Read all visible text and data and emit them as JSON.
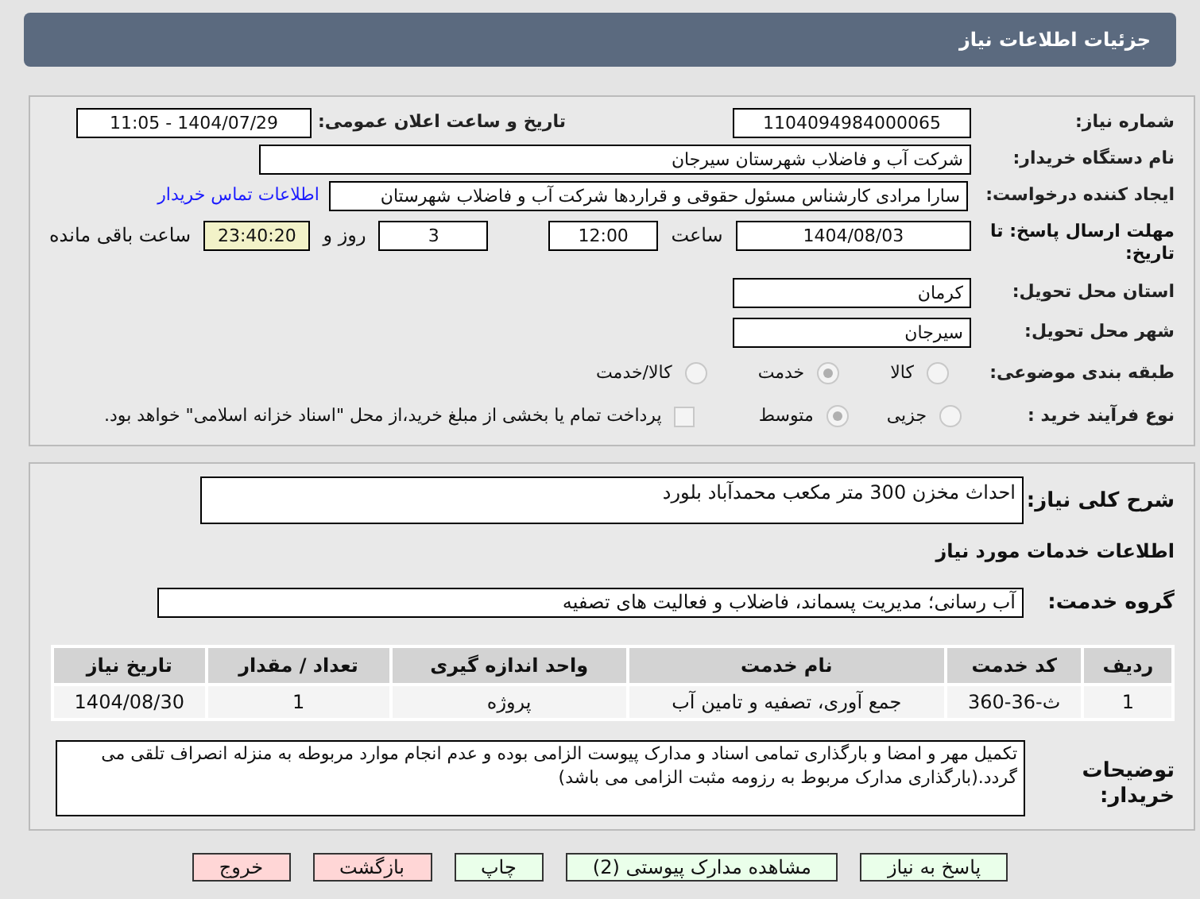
{
  "header": {
    "title": "جزئیات اطلاعات نیاز"
  },
  "details": {
    "need_number": {
      "label": "شماره نیاز:",
      "value": "1104094984000065"
    },
    "announce": {
      "label": "تاریخ و ساعت اعلان عمومی:",
      "value": "1404/07/29 - 11:05"
    },
    "buyer": {
      "label": "نام دستگاه خریدار:",
      "value": "شرکت آب و فاضلاب شهرستان سیرجان"
    },
    "creator": {
      "label": "ایجاد کننده درخواست:",
      "value": "سارا مرادی کارشناس مسئول حقوقی و قراردها شرکت آب و فاضلاب شهرستان",
      "link": "اطلاعات تماس خریدار"
    },
    "deadline": {
      "label": "مهلت ارسال پاسخ: تا تاریخ:",
      "date": "1404/08/03",
      "time_label": "ساعت",
      "time": "12:00",
      "days": "3",
      "days_label": "روز و",
      "remaining": "23:40:20",
      "remaining_label": "ساعت باقی مانده"
    },
    "province": {
      "label": "استان محل تحویل:",
      "value": "کرمان"
    },
    "city": {
      "label": "شهر محل تحویل:",
      "value": "سیرجان"
    },
    "category": {
      "label": "طبقه بندی موضوعی:",
      "options": [
        {
          "label": "کالا",
          "selected": false
        },
        {
          "label": "خدمت",
          "selected": true
        },
        {
          "label": "کالا/خدمت",
          "selected": false
        }
      ]
    },
    "process": {
      "label": "نوع فرآیند خرید :",
      "options": [
        {
          "label": "جزیی",
          "selected": false
        },
        {
          "label": "متوسط",
          "selected": true
        }
      ],
      "payment": {
        "label": "پرداخت تمام یا بخشی از مبلغ خرید،از محل \"اسناد خزانه اسلامی\" خواهد بود.",
        "checked": false
      }
    }
  },
  "description": {
    "label": "شرح کلی نیاز:",
    "value": "احداث مخزن 300 متر مکعب محمدآباد بلورد"
  },
  "services": {
    "heading": "اطلاعات خدمات مورد نیاز",
    "group_label": "گروه خدمت:",
    "group": "آب رسانی؛ مدیریت پسماند، فاضلاب و فعالیت های تصفیه",
    "table": {
      "columns": [
        "ردیف",
        "کد خدمت",
        "نام خدمت",
        "واحد اندازه گیری",
        "تعداد / مقدار",
        "تاریخ نیاز"
      ],
      "rows": [
        [
          "1",
          "ث-36-360",
          "جمع آوری، تصفیه و تامین آب",
          "پروژه",
          "1",
          "1404/08/30"
        ]
      ]
    }
  },
  "notes": {
    "label": "توضیحات خریدار:",
    "value": "تکمیل مهر و امضا و بارگذاری تمامی اسناد و مدارک پیوست الزامی بوده و عدم انجام موارد مربوطه به منزله انصراف تلقی می گردد.(بارگذاری مدارک مربوط به رزومه مثبت الزامی می باشد)"
  },
  "buttons": [
    {
      "label": "پاسخ به نیاز",
      "kind": "primary"
    },
    {
      "label": "مشاهده مدارک پیوستی (2)",
      "kind": "primary"
    },
    {
      "label": "چاپ",
      "kind": "primary"
    },
    {
      "label": "بازگشت",
      "kind": "danger"
    },
    {
      "label": "خروج",
      "kind": "danger"
    }
  ]
}
